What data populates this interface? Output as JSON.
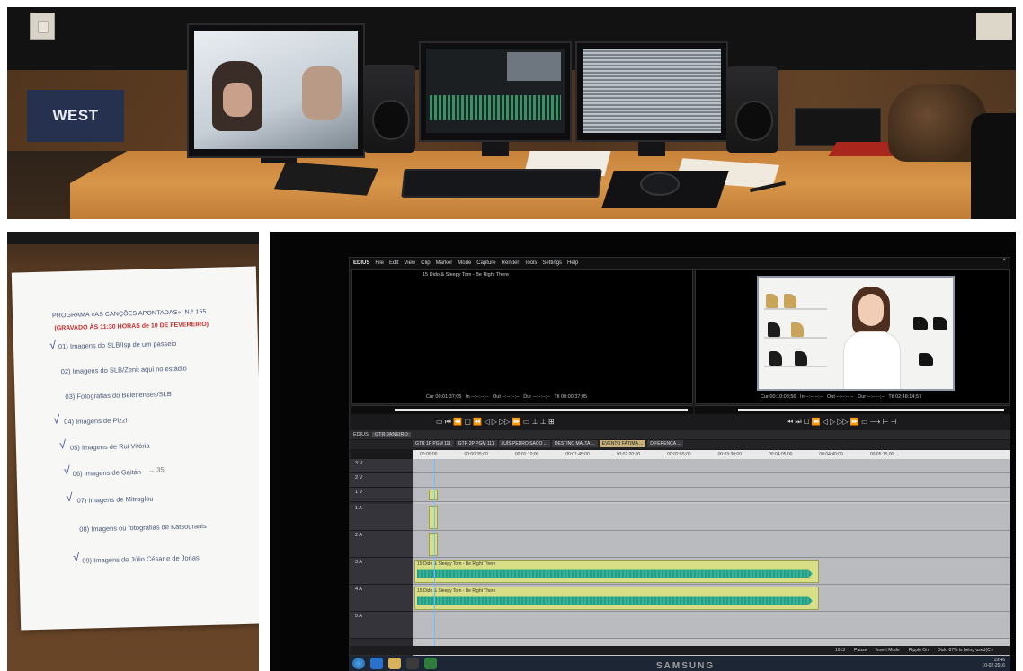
{
  "top_photo": {
    "sign_text": "WEST"
  },
  "paper": {
    "title": "PROGRAMA «AS CANÇÕES APONTADAS», N.º 155",
    "subtitle": "(GRAVADO ÀS 11:30 HORAS de 10 DE FEVEREIRO)",
    "items": [
      {
        "text": "01) Imagens do SLB/Isp de um passeio",
        "checked": true
      },
      {
        "text": "02) Imagens do SLB/Zenit aqui no estádio",
        "checked": false
      },
      {
        "text": "03) Fotografias do Belenenses/SLB",
        "checked": false
      },
      {
        "text": "04) Imagens de Pizzi",
        "checked": true
      },
      {
        "text": "05) Imagens de Rui Vitória",
        "checked": true
      },
      {
        "text": "06) Imagens de Gaitán",
        "checked": true
      },
      {
        "text": "07) Imagens de Mitroglou",
        "checked": true
      },
      {
        "text": "08) Imagens ou fotografias de Katsouranis",
        "checked": false
      },
      {
        "text": "09) Imagens de Júlio César e de Jonas",
        "checked": true
      }
    ],
    "annotation": "→ 35"
  },
  "edius": {
    "brand": "EDIUS",
    "menu": [
      "File",
      "Edit",
      "View",
      "Clip",
      "Marker",
      "Mode",
      "Capture",
      "Render",
      "Tools",
      "Settings",
      "Help"
    ],
    "close_label": "×",
    "player_clip_name": "15 Dido & Sleepy Tom - Be Right There",
    "player_timecodes": {
      "cur": "Cur 00:01:37;05",
      "in": "In --:--:--;--",
      "out": "Out --:--:--;--",
      "dur": "Dur --:--:--;--",
      "ttl": "Ttl 00:00:37;05"
    },
    "recorder_timecodes": {
      "cur": "Cur 00:10:08;56",
      "in": "In --:--:--;--",
      "out": "Out --:--:--;--",
      "dur": "Dur --:--:--;--",
      "ttl": "Ttl 02:48:14;57"
    },
    "transport_left": "▭ ⏮ ⏪ ▢ ⏪ ◁ ▷ ▷▷ ⏩ ▭ ⊥ ⊥ ⊞",
    "transport_right": "⏮ ⏭ ▢ ⏪ ◁ ▷ ▷▷ ⏩ ▭ ⟶ ⊢ ⊣",
    "project_label": "EDIUS",
    "project_name": "GTR JANEIRO",
    "sequence_tabs": [
      "GTR 1P PGM 111",
      "GTR 2P PGM 111",
      "LUÍS PEDRO SACO ...",
      "DESTINO MALTA ...",
      "EVENTO FÁTIMA ...",
      "DIFERENÇA ..."
    ],
    "active_tab": 4,
    "ruler_marks": [
      "00:00:00",
      "00:00:35;00",
      "00:01:10;00",
      "00:01:45;00",
      "00:02:20;00",
      "00:02:55;00",
      "00:03:30;00",
      "00:04:05;00",
      "00:04:40;00",
      "00:05:15;00",
      "00:05:50;00",
      "00:06:25;00",
      "00:07:00;00",
      "00:07:35;00",
      "00:08:10;00"
    ],
    "tracks": [
      {
        "name": "3 V",
        "type": "video"
      },
      {
        "name": "2 V",
        "type": "video"
      },
      {
        "name": "1 V",
        "type": "video"
      },
      {
        "name": "1 A",
        "type": "audio"
      },
      {
        "name": "2 A",
        "type": "audio"
      },
      {
        "name": "3 A",
        "type": "audio"
      },
      {
        "name": "4 A",
        "type": "audio"
      },
      {
        "name": "5 A",
        "type": "audio"
      }
    ],
    "audio_clip_label": "15 Dido & Sleepy Tom - Be Right There",
    "status": [
      "1013",
      "Pause",
      "Insert Mode",
      "Ripple On",
      "Disk: 87% is being used(C:)"
    ]
  },
  "taskbar": {
    "clock_time": "19:46",
    "clock_date": "10-02-2016"
  },
  "monitor_brand": "SAMSUNG"
}
